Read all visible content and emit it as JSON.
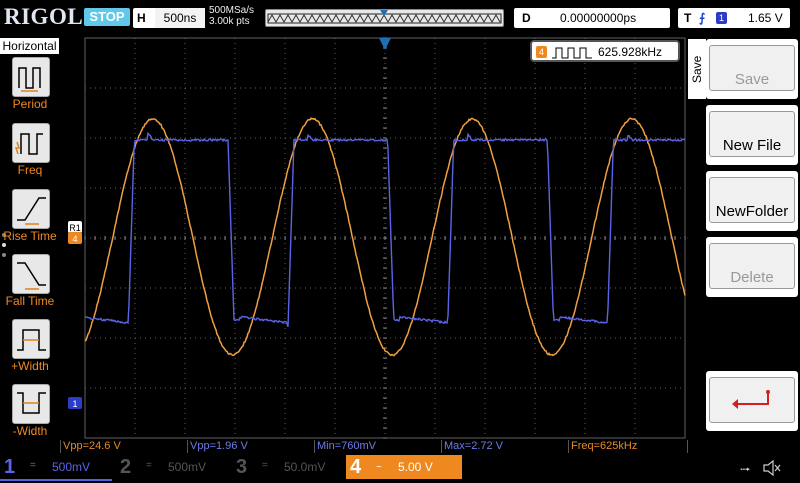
{
  "brand": "RIGOL",
  "status": "STOP",
  "horizontal": {
    "key": "H",
    "timebase": "500ns",
    "sample_rate": "500MSa/s",
    "points": "3.00k pts"
  },
  "delay": {
    "key": "D",
    "value": "0.00000000ps"
  },
  "trigger": {
    "key": "T",
    "edge_icon": "rising-edge-icon",
    "channel": "1",
    "level": "1.65 V"
  },
  "left_menu": {
    "title": "Horizontal",
    "items": [
      {
        "label": "Period",
        "icon": "period-icon"
      },
      {
        "label": "Freq",
        "icon": "freq-icon"
      },
      {
        "label": "Rise Time",
        "icon": "rise-time-icon"
      },
      {
        "label": "Fall Time",
        "icon": "fall-time-icon"
      },
      {
        "label": "+Width",
        "icon": "pos-width-icon"
      },
      {
        "label": "-Width",
        "icon": "neg-width-icon"
      }
    ]
  },
  "freq_readout": {
    "channel": "4",
    "value": "625.928kHz"
  },
  "markers": {
    "r1": "R1",
    "ch4": "4",
    "ch1": "1",
    "trig": "T"
  },
  "measurements": [
    {
      "text": "Vpp=24.6 V",
      "color": "#e98a24"
    },
    {
      "text": "Vpp=1.96 V",
      "color": "#6e7ce8"
    },
    {
      "text": "Min=760mV",
      "color": "#6e7ce8"
    },
    {
      "text": "Max=2.72 V",
      "color": "#6e7ce8"
    },
    {
      "text": "Freq=625kHz",
      "color": "#e98a24"
    }
  ],
  "right_menu": {
    "title": "Save",
    "buttons": [
      {
        "label": "Save",
        "enabled": false
      },
      {
        "label": "New File",
        "enabled": true
      },
      {
        "label": "NewFolder",
        "enabled": true
      },
      {
        "label": "Delete",
        "enabled": false
      },
      {
        "label": "",
        "icon": "return-icon",
        "enabled": true
      }
    ]
  },
  "channels": [
    {
      "num": "1",
      "coupling": "=",
      "scale": "500mV",
      "color": "#5060e6",
      "active": true
    },
    {
      "num": "2",
      "coupling": "=",
      "scale": "500mV",
      "color": "#555555",
      "active": false
    },
    {
      "num": "3",
      "coupling": "=",
      "scale": "50.0mV",
      "color": "#555555",
      "active": false
    },
    {
      "num": "4",
      "coupling": "~",
      "scale": "5.00 V",
      "color": "#f08820",
      "active": true
    }
  ],
  "colors": {
    "ch1": "#5a64e8",
    "ch4": "#f0a040",
    "grid": "#606060"
  },
  "bottom_icons": [
    "usb-icon",
    "speaker-muted-icon"
  ]
}
